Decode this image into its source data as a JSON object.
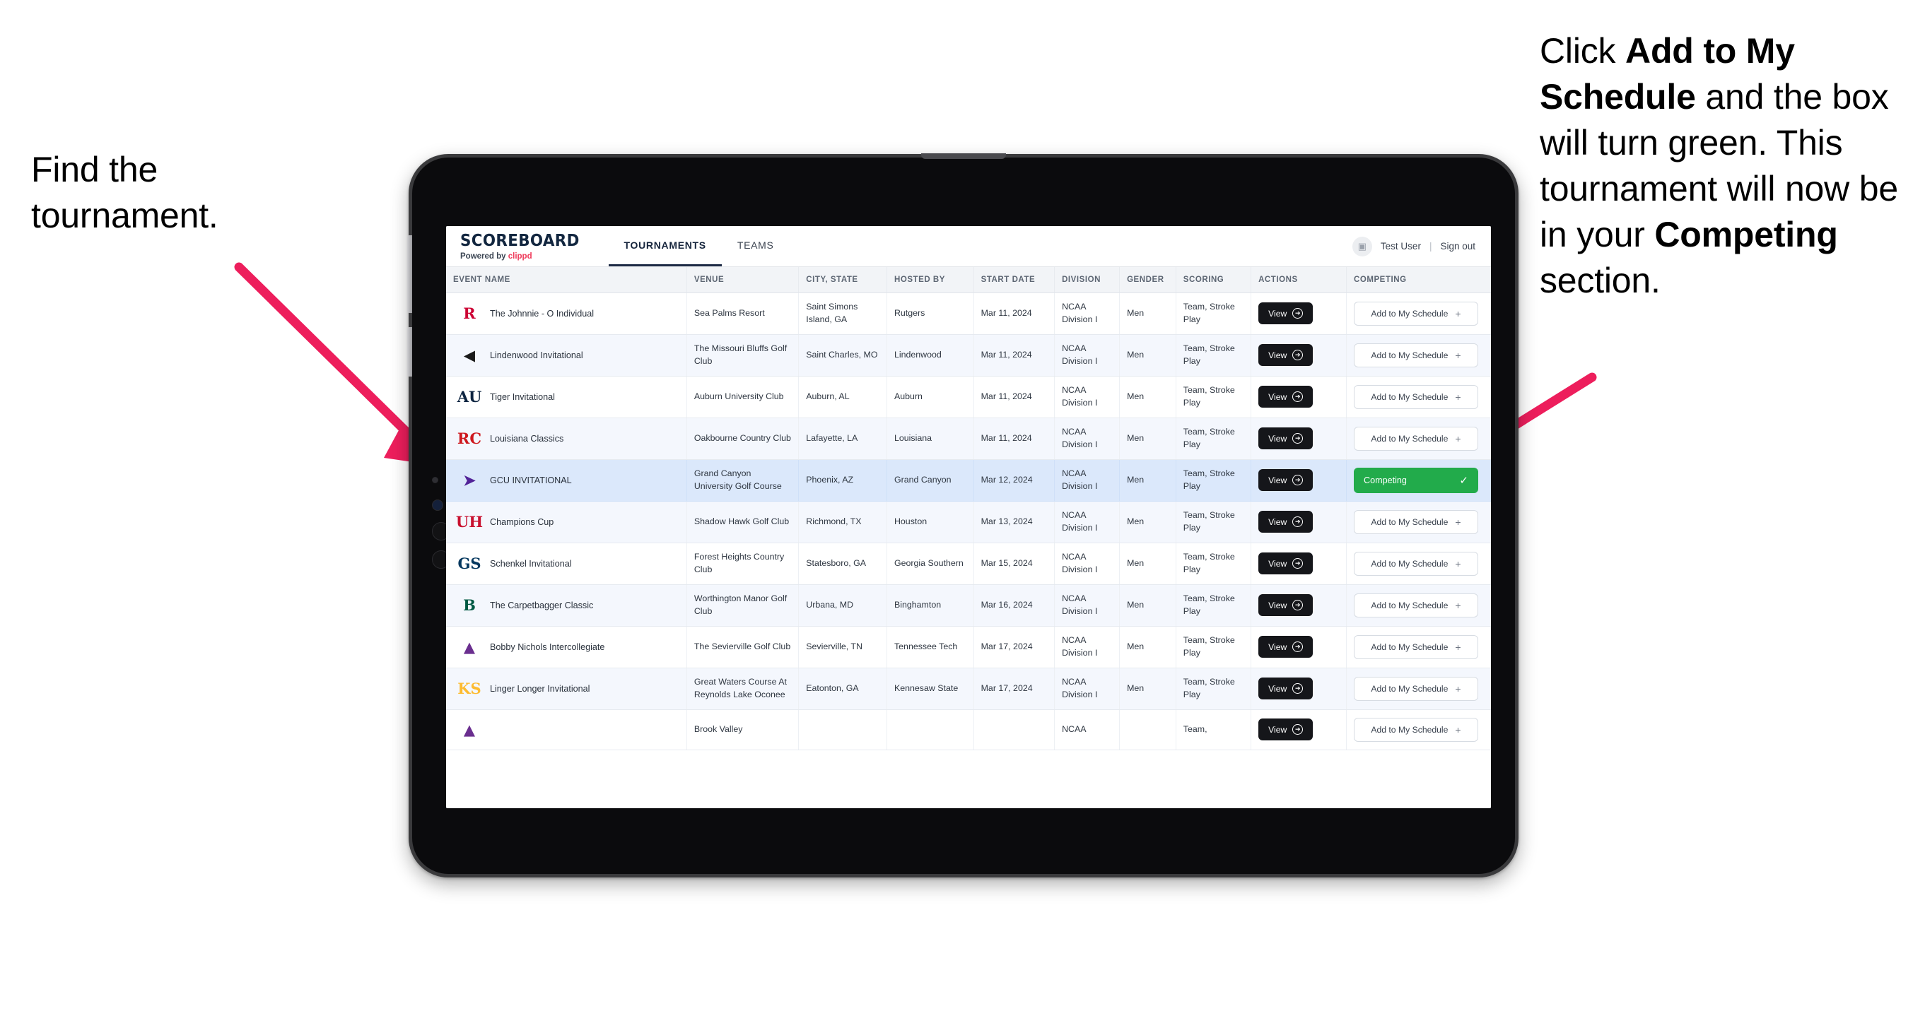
{
  "annotations": {
    "left": {
      "line1": "Find the",
      "line2": "tournament."
    },
    "right": {
      "seg1": "Click ",
      "seg2_bold": "Add to My Schedule",
      "seg3": " and the box will turn green. This tournament will now be in your ",
      "seg4_bold": "Competing",
      "seg5": " section."
    },
    "arrow_color": "#ED1E5C"
  },
  "app": {
    "brand": {
      "name": "SCOREBOARD",
      "powered_prefix": "Powered by ",
      "powered_brand": "clippd"
    },
    "tabs": [
      {
        "label": "TOURNAMENTS",
        "active": true
      },
      {
        "label": "TEAMS",
        "active": false
      }
    ],
    "user": {
      "avatar_icon": "user-avatar-icon",
      "name": "Test User",
      "separator": "|",
      "signout": "Sign out"
    }
  },
  "table": {
    "columns": [
      "EVENT NAME",
      "VENUE",
      "CITY, STATE",
      "HOSTED BY",
      "START DATE",
      "DIVISION",
      "GENDER",
      "SCORING",
      "ACTIONS",
      "COMPETING"
    ],
    "action_label": "View",
    "add_label": "Add to My Schedule",
    "add_icon": "plus-icon",
    "competing_label": "Competing",
    "competing_icon": "check-icon",
    "competing_color": "#22AB4B",
    "rows": [
      {
        "event": "The Johnnie - O Individual",
        "venue": "Sea Palms Resort",
        "city": "Saint Simons Island, GA",
        "host": "Rutgers",
        "date": "Mar 11, 2024",
        "division": "NCAA Division I",
        "gender": "Men",
        "scoring": "Team, Stroke Play",
        "competing": false,
        "logo": {
          "glyph": "R",
          "color": "#CC0033",
          "name": "rutgers-logo"
        }
      },
      {
        "event": "Lindenwood Invitational",
        "venue": "The Missouri Bluffs Golf Club",
        "city": "Saint Charles, MO",
        "host": "Lindenwood",
        "date": "Mar 11, 2024",
        "division": "NCAA Division I",
        "gender": "Men",
        "scoring": "Team, Stroke Play",
        "competing": false,
        "logo": {
          "glyph": "◀",
          "color": "#1a1a1a",
          "name": "lindenwood-lion-logo"
        }
      },
      {
        "event": "Tiger Invitational",
        "venue": "Auburn University Club",
        "city": "Auburn, AL",
        "host": "Auburn",
        "date": "Mar 11, 2024",
        "division": "NCAA Division I",
        "gender": "Men",
        "scoring": "Team, Stroke Play",
        "competing": false,
        "logo": {
          "glyph": "AU",
          "color": "#0C2340",
          "name": "auburn-logo"
        }
      },
      {
        "event": "Louisiana Classics",
        "venue": "Oakbourne Country Club",
        "city": "Lafayette, LA",
        "host": "Louisiana",
        "date": "Mar 11, 2024",
        "division": "NCAA Division I",
        "gender": "Men",
        "scoring": "Team, Stroke Play",
        "competing": false,
        "logo": {
          "glyph": "RC",
          "color": "#CE181E",
          "name": "ragin-cajuns-logo"
        }
      },
      {
        "event": "GCU INVITATIONAL",
        "venue": "Grand Canyon University Golf Course",
        "city": "Phoenix, AZ",
        "host": "Grand Canyon",
        "date": "Mar 12, 2024",
        "division": "NCAA Division I",
        "gender": "Men",
        "scoring": "Team, Stroke Play",
        "competing": true,
        "highlight": true,
        "logo": {
          "glyph": "➤",
          "color": "#522398",
          "name": "grand-canyon-lopes-logo"
        }
      },
      {
        "event": "Champions Cup",
        "venue": "Shadow Hawk Golf Club",
        "city": "Richmond, TX",
        "host": "Houston",
        "date": "Mar 13, 2024",
        "division": "NCAA Division I",
        "gender": "Men",
        "scoring": "Team, Stroke Play",
        "competing": false,
        "logo": {
          "glyph": "UH",
          "color": "#C8102E",
          "name": "houston-logo"
        }
      },
      {
        "event": "Schenkel Invitational",
        "venue": "Forest Heights Country Club",
        "city": "Statesboro, GA",
        "host": "Georgia Southern",
        "date": "Mar 15, 2024",
        "division": "NCAA Division I",
        "gender": "Men",
        "scoring": "Team, Stroke Play",
        "competing": false,
        "logo": {
          "glyph": "GS",
          "color": "#04385F",
          "name": "georgia-southern-logo"
        }
      },
      {
        "event": "The Carpetbagger Classic",
        "venue": "Worthington Manor Golf Club",
        "city": "Urbana, MD",
        "host": "Binghamton",
        "date": "Mar 16, 2024",
        "division": "NCAA Division I",
        "gender": "Men",
        "scoring": "Team, Stroke Play",
        "competing": false,
        "logo": {
          "glyph": "B",
          "color": "#005A43",
          "name": "binghamton-logo"
        }
      },
      {
        "event": "Bobby Nichols Intercollegiate",
        "venue": "The Sevierville Golf Club",
        "city": "Sevierville, TN",
        "host": "Tennessee Tech",
        "date": "Mar 17, 2024",
        "division": "NCAA Division I",
        "gender": "Men",
        "scoring": "Team, Stroke Play",
        "competing": false,
        "logo": {
          "glyph": "▲",
          "color": "#6A2E8F",
          "name": "tennessee-tech-eagle-logo"
        }
      },
      {
        "event": "Linger Longer Invitational",
        "venue": "Great Waters Course At Reynolds Lake Oconee",
        "city": "Eatonton, GA",
        "host": "Kennesaw State",
        "date": "Mar 17, 2024",
        "division": "NCAA Division I",
        "gender": "Men",
        "scoring": "Team, Stroke Play",
        "competing": false,
        "logo": {
          "glyph": "KS",
          "color": "#FDBB30",
          "name": "kennesaw-state-logo"
        }
      }
    ],
    "cut_row": {
      "venue": "Brook Valley",
      "division": "NCAA",
      "scoring": "Team,"
    }
  }
}
